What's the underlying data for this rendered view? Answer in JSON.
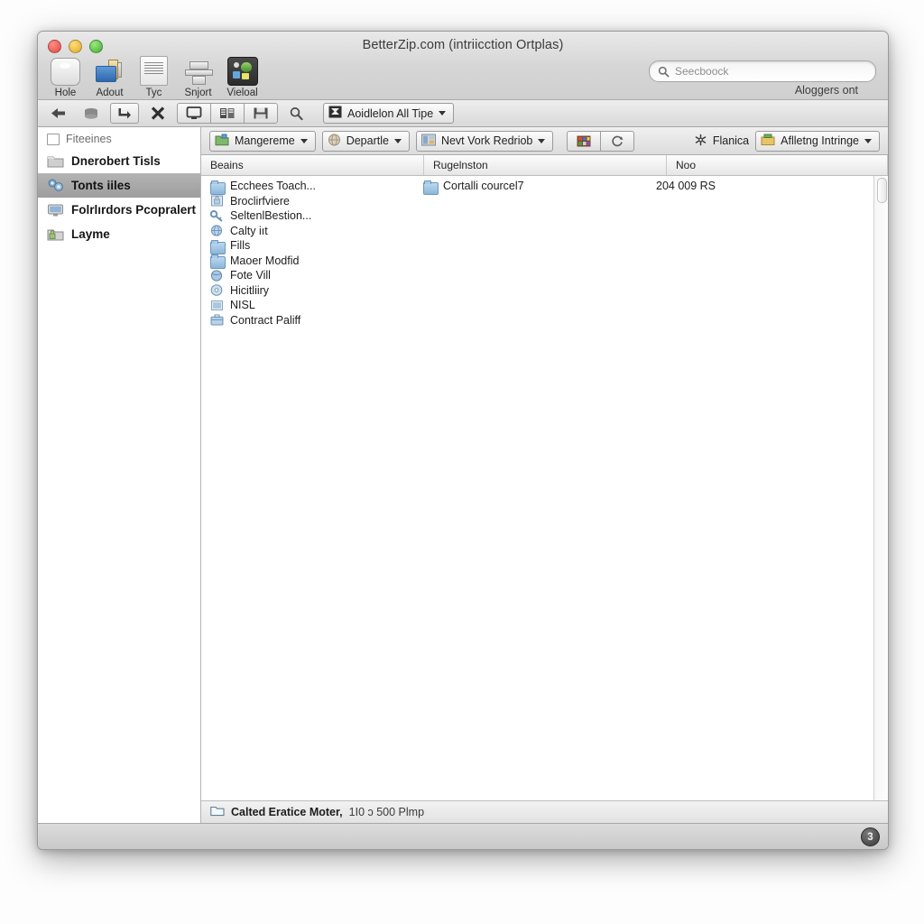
{
  "window": {
    "title": "BetterZip.com (intriicction Ortplas)"
  },
  "toolbar": {
    "items": [
      {
        "label": "Hole",
        "icon": "archive-box-icon"
      },
      {
        "label": "Adout",
        "icon": "extract-folder-icon"
      },
      {
        "label": "Tyc",
        "icon": "document-list-icon"
      },
      {
        "label": "Snjort",
        "icon": "align-rows-icon"
      },
      {
        "label": "Vieloal",
        "icon": "preview-dark-icon"
      }
    ],
    "search_placeholder": "Seecboock",
    "search_value": "",
    "right_caption": "Aloggers ont"
  },
  "subtoolbar": {
    "buttons": [
      {
        "name": "back-arrow-icon"
      },
      {
        "name": "archive-icon"
      },
      {
        "name": "forward-arrow-icon"
      },
      {
        "name": "delete-x-icon"
      },
      {
        "name": "monitor-icon"
      },
      {
        "name": "keyboard-icon"
      },
      {
        "name": "save-disk-icon"
      },
      {
        "name": "magnifier-icon"
      }
    ],
    "filter_popup": "Aoidlelon All Tipe"
  },
  "sidebar": {
    "header": "Fiteeines",
    "items": [
      {
        "label": "Dnerobert Tisls",
        "icon": "folder-icon",
        "selected": false
      },
      {
        "label": "Tonts iiles",
        "icon": "gears-files-icon",
        "selected": true
      },
      {
        "label": "Folrlırdors Pcopralert",
        "icon": "monitor-folder-icon",
        "selected": false
      },
      {
        "label": "Layme",
        "icon": "lock-folder-icon",
        "selected": false
      }
    ]
  },
  "filterbar": {
    "popups": [
      {
        "label": "Mangereme",
        "icon": "green-archive-icon"
      },
      {
        "label": "Departle",
        "icon": "globe-icon"
      },
      {
        "label": "Nevt Vork Redriob",
        "icon": "network-icon"
      }
    ],
    "group_buttons": [
      {
        "name": "color-grid-icon"
      },
      {
        "name": "refresh-icon"
      }
    ],
    "plain": {
      "label": "Flanica",
      "icon": "gear-snowflake-icon"
    },
    "right_popup": {
      "label": "Aflletng Intringe",
      "icon": "yellow-archive-icon"
    }
  },
  "columns": {
    "headers": [
      "Beains",
      "Rugelnston",
      "Noo"
    ]
  },
  "files": {
    "name_column": [
      {
        "label": "Ecchees Toach...",
        "icon": "folder-icon"
      },
      {
        "label": "Broclirfviere",
        "icon": "lock-disk-icon"
      },
      {
        "label": "SeltenlBestion...",
        "icon": "key-icon"
      },
      {
        "label": "Calty iıt",
        "icon": "globe-icon"
      },
      {
        "label": "Fills",
        "icon": "folder-icon"
      },
      {
        "label": "Maoer Modfid",
        "icon": "folder-icon"
      },
      {
        "label": "Fote Vill",
        "icon": "globe-icon"
      },
      {
        "label": "Hicitliiry",
        "icon": "disc-icon"
      },
      {
        "label": "NISL",
        "icon": "window-icon"
      },
      {
        "label": "Contract Paliff",
        "icon": "briefcase-icon"
      }
    ],
    "region_column": [
      {
        "label": "Cortalli courcel7",
        "icon": "folder-icon"
      }
    ],
    "size_column": [
      {
        "label": "204 009 RS"
      }
    ]
  },
  "status": {
    "icon": "open-folder-icon",
    "strong": "Calted Eratice Moter,",
    "rest": "1I0 ɔ 500 Plmp"
  },
  "bottom": {
    "badge": "3"
  },
  "colors": {
    "window_chrome": "#d6d6d6",
    "selection": "#a8a8a8",
    "folder_blue": "#8cb6da"
  }
}
